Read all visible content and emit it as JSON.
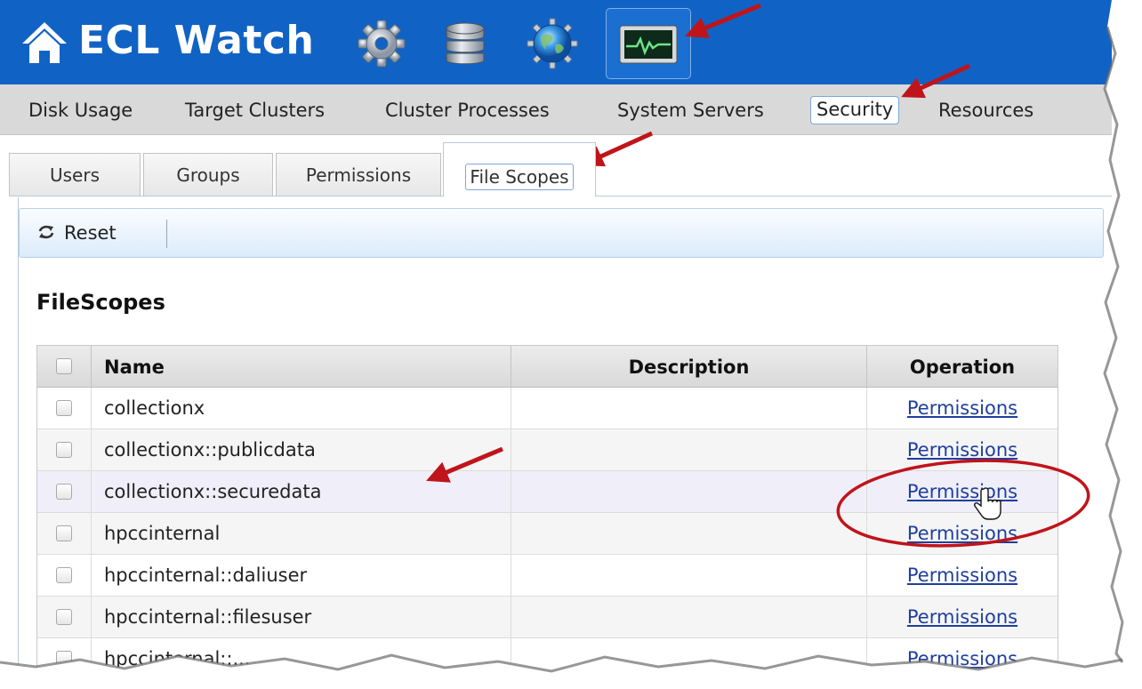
{
  "app": {
    "title": "ECL Watch"
  },
  "main_nav": {
    "items": [
      {
        "label": "Disk Usage"
      },
      {
        "label": "Target Clusters"
      },
      {
        "label": "Cluster Processes"
      },
      {
        "label": "System Servers"
      },
      {
        "label": "Security",
        "active": true
      },
      {
        "label": "Resources"
      }
    ]
  },
  "sub_tabs": {
    "items": [
      {
        "label": "Users"
      },
      {
        "label": "Groups"
      },
      {
        "label": "Permissions"
      },
      {
        "label": "File Scopes",
        "active": true
      }
    ]
  },
  "toolbar": {
    "reset_label": "Reset"
  },
  "section": {
    "title": "FileScopes"
  },
  "grid": {
    "columns": {
      "name": "Name",
      "description": "Description",
      "operation": "Operation"
    },
    "rows": [
      {
        "name": "collectionx",
        "description": "",
        "operation": "Permissions"
      },
      {
        "name": "collectionx::publicdata",
        "description": "",
        "operation": "Permissions"
      },
      {
        "name": "collectionx::securedata",
        "description": "",
        "operation": "Permissions"
      },
      {
        "name": "hpccinternal",
        "description": "",
        "operation": "Permissions"
      },
      {
        "name": "hpccinternal::daliuser",
        "description": "",
        "operation": "Permissions"
      },
      {
        "name": "hpccinternal::filesuser",
        "description": "",
        "operation": "Permissions"
      },
      {
        "name": "hpccinternal::...",
        "description": "",
        "operation": "Permissions"
      }
    ]
  },
  "icons": {
    "header": [
      "home-icon",
      "gear-icon",
      "database-icon",
      "globe-icon",
      "monitor-icon"
    ],
    "toolbar": [
      "reset-icon"
    ]
  },
  "colors": {
    "header_bg": "#1063c4",
    "nav_bg": "#d9d9d9",
    "link": "#1f3f9e",
    "annotation_red": "#c0141b"
  }
}
